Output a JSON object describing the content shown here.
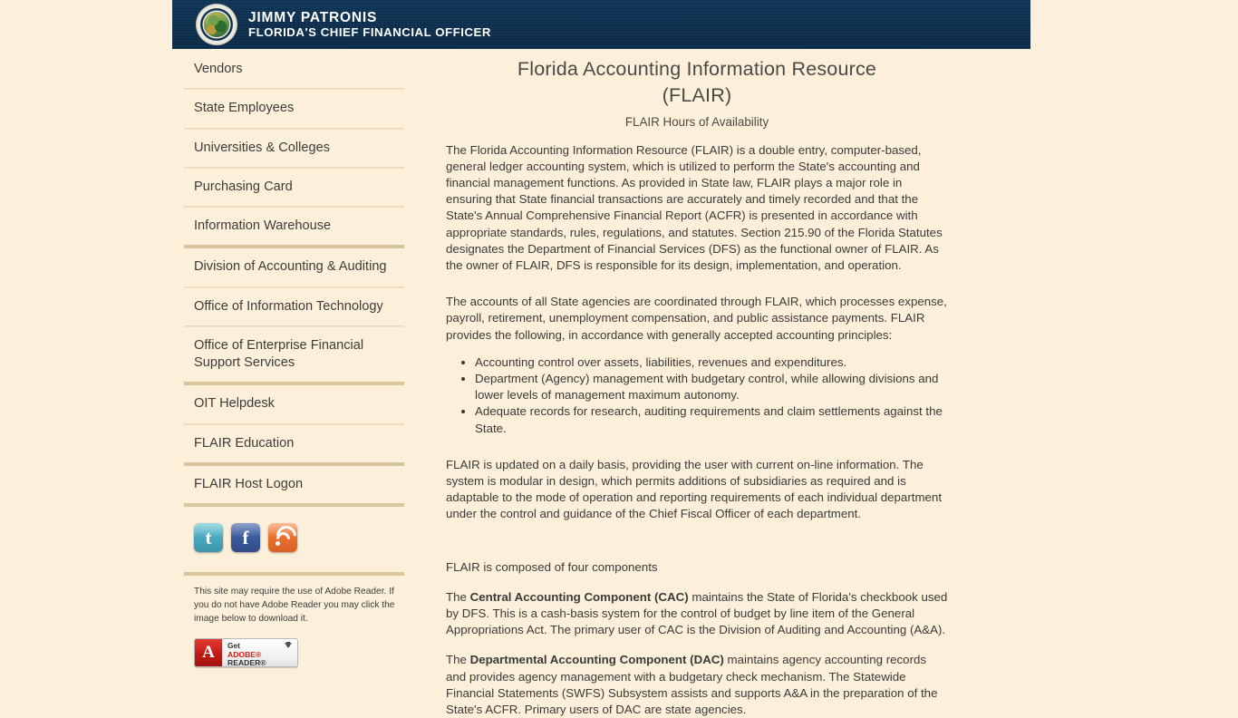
{
  "header": {
    "officer_name": "JIMMY PATRONIS",
    "officer_title": "FLORIDA'S CHIEF FINANCIAL OFFICER",
    "seal_icon": "florida-state-seal-icon",
    "banner_color": "#0b2d4c"
  },
  "sidebar": {
    "items": [
      {
        "label": "Vendors",
        "divider_after": "thin"
      },
      {
        "label": "State Employees",
        "divider_after": "thin"
      },
      {
        "label": "Universities & Colleges",
        "divider_after": "thin"
      },
      {
        "label": "Purchasing Card",
        "divider_after": "thin"
      },
      {
        "label": "Information Warehouse",
        "divider_after": "thick"
      },
      {
        "label": "Division of Accounting & Auditing",
        "divider_after": "thin"
      },
      {
        "label": "Office of Information Technology",
        "divider_after": "thin"
      },
      {
        "label": "Office of Enterprise Financial Support Services",
        "divider_after": "thick"
      },
      {
        "label": "OIT Helpdesk",
        "divider_after": "thin"
      },
      {
        "label": "FLAIR Education",
        "divider_after": "thick"
      },
      {
        "label": "FLAIR Host Logon",
        "divider_after": "thick"
      }
    ],
    "social": [
      {
        "name": "twitter-icon",
        "glyph": "t",
        "color": "#49a9bd"
      },
      {
        "name": "facebook-icon",
        "glyph": "f",
        "color": "#3b5a9b"
      },
      {
        "name": "rss-icon",
        "glyph": "",
        "color": "#e8702f"
      }
    ],
    "adobe": {
      "note": "This site may require the use of Adobe Reader. If you do not have Adobe Reader you may click the image below to download it.",
      "button_get": "Get",
      "button_brand": "ADOBE®",
      "button_product": "READER®",
      "button_glyph": "A"
    }
  },
  "main": {
    "title_line1": "Florida Accounting Information Resource",
    "title_line2": "(FLAIR)",
    "subtitle": "FLAIR Hours of Availability",
    "paragraph1": "The Florida Accounting Information Resource (FLAIR) is a double entry, computer-based, general ledger accounting system, which is utilized to perform the State's accounting and financial management functions. As provided in State law, FLAIR plays a major role in ensuring that State financial transactions are accurately and timely recorded and that the State's Annual Comprehensive Financial Report (ACFR) is presented in accordance with appropriate standards, rules, regulations, and statutes. Section 215.90 of the Florida Statutes designates the Department of Financial Services (DFS) as the functional owner of FLAIR. As the owner of FLAIR, DFS is responsible for its design, implementation, and operation.",
    "paragraph2": "The accounts of all State agencies are coordinated through FLAIR, which processes expense, payroll, retirement, unemployment compensation, and public assistance payments. FLAIR provides the following, in accordance with generally accepted accounting principles:",
    "bullets": [
      "Accounting control over assets, liabilities, revenues and expenditures.",
      "Department (Agency) management with budgetary control, while allowing divisions and lower levels of management maximum autonomy.",
      "Adequate records for research, auditing requirements and claim settlements against the State."
    ],
    "paragraph3": "FLAIR is updated on a daily basis, providing the user with current on-line information. The system is modular in design, which permits additions of subsidiaries as required and is adaptable to the mode of operation and reporting requirements of each individual department under the control and guidance of the Chief Fiscal Officer of each department.",
    "components_intro": "FLAIR is composed of four components",
    "cac_prefix": "The ",
    "cac_bold": "Central Accounting Component (CAC)",
    "cac_rest": " maintains the State of Florida's checkbook used by DFS. This is a cash-basis system for the control of budget by line item of the General Appropriations Act. The primary user of CAC is the Division of Auditing and Accounting (A&A).",
    "dac_prefix": "The ",
    "dac_bold": "Departmental Accounting Component (DAC)",
    "dac_rest": " maintains agency accounting records and provides agency management with a budgetary check mechanism. The Statewide Financial Statements (SWFS) Subsystem assists and supports A&A in the preparation of the State's ACFR. Primary users of DAC are state agencies."
  }
}
